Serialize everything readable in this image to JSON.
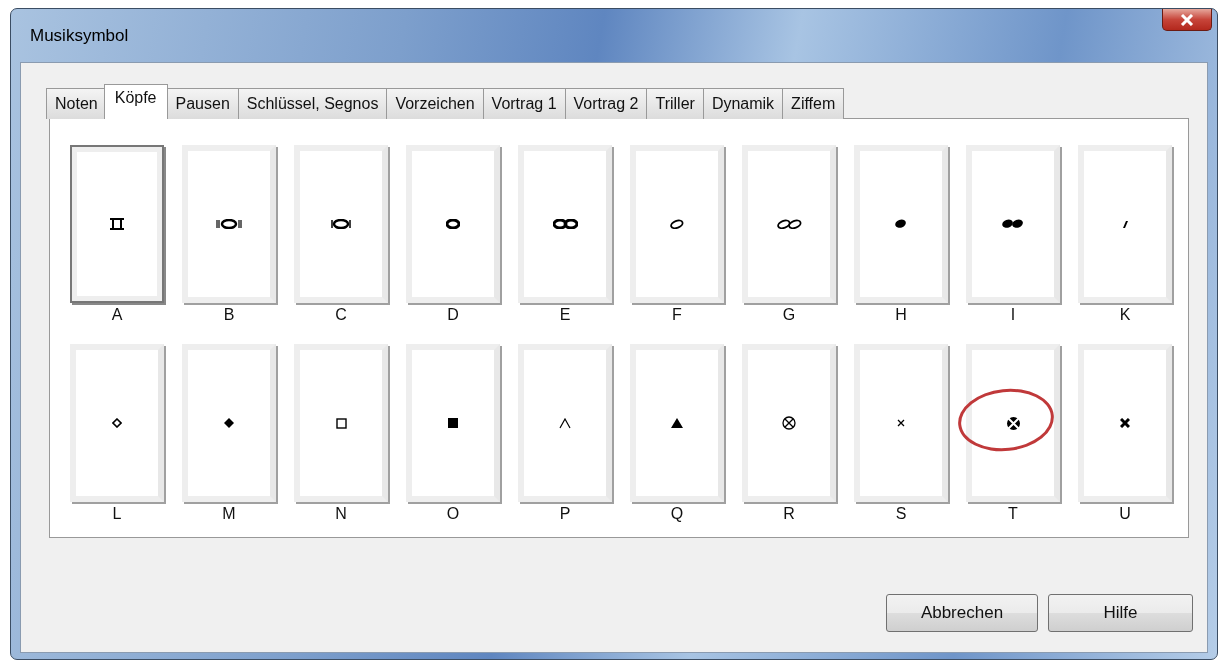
{
  "window": {
    "title": "Musiksymbol"
  },
  "tabs": [
    {
      "label": "Noten",
      "selected": false
    },
    {
      "label": "Köpfe",
      "selected": true
    },
    {
      "label": "Pausen",
      "selected": false
    },
    {
      "label": "Schlüssel, Segnos",
      "selected": false
    },
    {
      "label": "Vorzeichen",
      "selected": false
    },
    {
      "label": "Vortrag 1",
      "selected": false
    },
    {
      "label": "Vortrag 2",
      "selected": false
    },
    {
      "label": "Triller",
      "selected": false
    },
    {
      "label": "Dynamik",
      "selected": false
    },
    {
      "label": "Ziffem",
      "selected": false
    }
  ],
  "symbols": [
    {
      "label": "A",
      "selected": true,
      "highlighted": false
    },
    {
      "label": "B",
      "selected": false,
      "highlighted": false
    },
    {
      "label": "C",
      "selected": false,
      "highlighted": false
    },
    {
      "label": "D",
      "selected": false,
      "highlighted": false
    },
    {
      "label": "E",
      "selected": false,
      "highlighted": false
    },
    {
      "label": "F",
      "selected": false,
      "highlighted": false
    },
    {
      "label": "G",
      "selected": false,
      "highlighted": false
    },
    {
      "label": "H",
      "selected": false,
      "highlighted": false
    },
    {
      "label": "I",
      "selected": false,
      "highlighted": false
    },
    {
      "label": "K",
      "selected": false,
      "highlighted": false
    },
    {
      "label": "L",
      "selected": false,
      "highlighted": false
    },
    {
      "label": "M",
      "selected": false,
      "highlighted": false
    },
    {
      "label": "N",
      "selected": false,
      "highlighted": false
    },
    {
      "label": "O",
      "selected": false,
      "highlighted": false
    },
    {
      "label": "P",
      "selected": false,
      "highlighted": false
    },
    {
      "label": "Q",
      "selected": false,
      "highlighted": false
    },
    {
      "label": "R",
      "selected": false,
      "highlighted": false
    },
    {
      "label": "S",
      "selected": false,
      "highlighted": false
    },
    {
      "label": "T",
      "selected": false,
      "highlighted": true
    },
    {
      "label": "U",
      "selected": false,
      "highlighted": false
    }
  ],
  "buttons": [
    "Abbrechen",
    "Hilfe"
  ]
}
